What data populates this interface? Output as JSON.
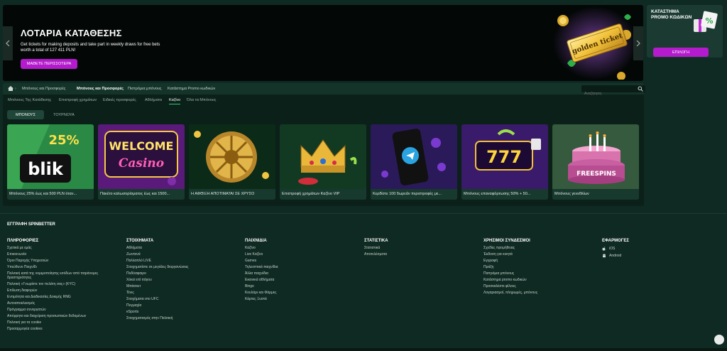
{
  "hero": {
    "title": "ΛΟΤΑΡΙΑ ΚΑΤΑΘΕΣΗΣ",
    "text": "Get tickets for making deposits and take part in weekly draws for free bets worth a total of 127 411 PLN!",
    "button": "ΜΑΘΕΤΕ ΠΕΡΙΣΣΟΤΕΡΑ",
    "ticket_text": "golden ticket"
  },
  "promo": {
    "title": "ΚΑΤΑΣΤΗΜΑ PROMO ΚΩΔΙΚΩΝ",
    "button": "ΕΠΙΛΟΓΗ"
  },
  "breadcrumb": {
    "items": [
      "Μπόνους και Προσφορές",
      "Μπόνους και Προσφορές",
      "Πιστρόμια μπόνους",
      "Κατάστημα Promo κωδικών"
    ]
  },
  "search": {
    "placeholder": "Αναζήτηση"
  },
  "subnav": [
    "Μπόνους Της Κατάθεσης",
    "Επιστροφή χρημάτων",
    "Ειδικές προσφορές",
    "Αθλήματα",
    "Καζίνο",
    "Όλα τα Μπόνους"
  ],
  "toggle": {
    "bonus": "ΜΠΟΝΟΥΣ",
    "tournaments": "ΤΟΥΡΝΟΥΑ"
  },
  "cards": [
    {
      "label": "Μπόνους 25% έως και 500 PLN όταν...",
      "art_big": "25%",
      "art_small": "blik"
    },
    {
      "label": "Πακέτο καλωσορίσματος έως και 1500...",
      "art_big": "WELCOME",
      "art_small": "Casino"
    },
    {
      "label": "Η ΑΦΘΙΞΗ ΑΠΟΤΙΜΑΤΑΙ ΣΕ ΧΡΥΣΟ"
    },
    {
      "label": "Επιστροφή χρημάτων Καζίνο VIP"
    },
    {
      "label": "Κερδίστε 100 δωρεάν περιστροφές με..."
    },
    {
      "label": "Μπόνους επαναφόρτωσης 50% + 50...",
      "art_big": "777"
    },
    {
      "label": "Μπόνους γενεθλίων",
      "art_small": "FREESPINS"
    }
  ],
  "footer": {
    "signup": "ΕΓΓΡΑΦΗ SPINBETTER",
    "columns": [
      {
        "title": "ΠΛΗΡΟΦΟΡΙΕΣ",
        "links": [
          "Σχετικά με εμάς",
          "Επικοινωνία",
          "Όροι Παροχής Υπηρεσιών",
          "Υπεύθυνο Παιχνίδι",
          "Πολιτική κατά της νομιμοποίησης εσόδων από παράνομες δραστηριότητες",
          "Πολιτική «Γνωρίστε τον πελάτη σας» (KYC)",
          "Επίλυση διαφορών",
          "Εντιμότητα και Διαδικασίες Δοκιμής RNG",
          "Αυτοαποκλεισμός",
          "Πρόγραμμα συνεργατών",
          "Απόρρητο και διαχείριση προσωπικών δεδομένων",
          "Πολιτική για τα cookie",
          "Προσαρμογέα cookies"
        ]
      },
      {
        "title": "ΣΤΟΙΧΗΜΑΤΑ",
        "links": [
          "Αθλήματα",
          "Ζωντανά",
          "Πολλαπλό LIVE",
          "Στοιχηματίστε σε μεγάλες διοργανώσεις",
          "Ποδόσφαιρο",
          "Χόκεϊ επί πάγου",
          "Μπάσκετ",
          "Τένις",
          "Στοιχήματα στο UFC",
          "Πυγμαχία",
          "eSports",
          "Στοιχηματισμός στην Πολιτική"
        ]
      },
      {
        "title": "ΠΑΙΧΝΙΔΙΑ",
        "links": [
          "Καζίνο",
          "Live Καζίνο",
          "Games",
          "Τηλεοπτικά παιχνίδια",
          "Άλλα παιχνίδια",
          "Εικονικά αθλήματα",
          "Bingo",
          "Κουλάρι και Φάρμες",
          "Κάρτες Ξυστά"
        ]
      },
      {
        "title": "ΣΤΑΤΙΣΤΙΚΑ",
        "links": [
          "Στατιστικά",
          "Αποτελέσματα"
        ]
      },
      {
        "title": "ΧΡΗΣΙΜΟΙ ΣΥΝΔΕΣΜΟΙ",
        "links": [
          "Σχεδίες προμήθειας",
          "Έκδοση για κινητά",
          "Εγγραφή",
          "Πράξη",
          "Πιστρόμια μπόνους",
          "Κατάστημα promo κωδικών",
          "Προσκαλέστε φίλους",
          "Λογαριασμοί, πληρωμές, μπόνους"
        ]
      },
      {
        "title": "ΕΦΑΡΜΟΓΕΣ",
        "links": [
          "iOS",
          "Android"
        ]
      }
    ]
  }
}
